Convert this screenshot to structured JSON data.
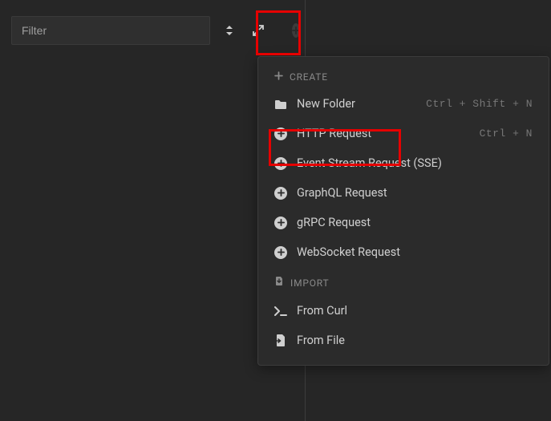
{
  "toolbar": {
    "filter_placeholder": "Filter"
  },
  "menu": {
    "sections": {
      "create": {
        "header": "CREATE",
        "items": {
          "new_folder": {
            "label": "New Folder",
            "shortcut": "Ctrl + Shift + N"
          },
          "http_request": {
            "label": "HTTP Request",
            "shortcut": "Ctrl + N"
          },
          "sse": {
            "label": "Event Stream Request (SSE)",
            "shortcut": ""
          },
          "graphql": {
            "label": "GraphQL Request",
            "shortcut": ""
          },
          "grpc": {
            "label": "gRPC Request",
            "shortcut": ""
          },
          "websocket": {
            "label": "WebSocket Request",
            "shortcut": ""
          }
        }
      },
      "import": {
        "header": "IMPORT",
        "items": {
          "from_curl": {
            "label": "From Curl",
            "shortcut": ""
          },
          "from_file": {
            "label": "From File",
            "shortcut": ""
          }
        }
      }
    }
  }
}
